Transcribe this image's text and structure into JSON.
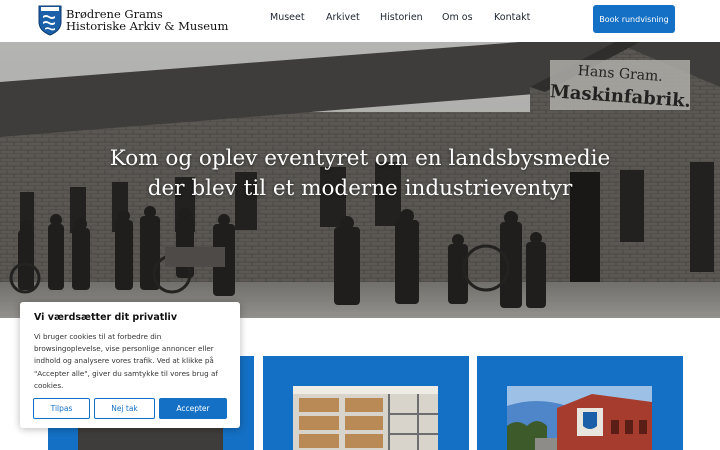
{
  "header": {
    "logo_line1": "Brødrene Grams",
    "logo_line2": "Historiske Arkiv & Museum",
    "nav": [
      {
        "label": "Museet"
      },
      {
        "label": "Arkivet"
      },
      {
        "label": "Historien"
      },
      {
        "label": "Om os"
      },
      {
        "label": "Kontakt"
      }
    ],
    "cta_label": "Book rundvisning"
  },
  "hero": {
    "title_line1": "Kom og oplev eventyret om en landsbysmedie",
    "title_line2": "der blev til et moderne industrieventyr",
    "sign_line1": "Hans Gram.",
    "sign_line2": "Maskinfabrik."
  },
  "cookie": {
    "title": "Vi værdsætter dit privatliv",
    "body": "Vi bruger cookies til at forbedre din browsingoplevelse, vise personlige annoncer eller indhold og analysere vores trafik. Ved at klikke på \"Accepter alle\", giver du samtykke til vores brug af cookies.",
    "customize_label": "Tilpas",
    "reject_label": "Nej tak",
    "accept_label": "Accepter"
  },
  "colors": {
    "accent": "#1470c4",
    "header_bg": "#ffffff",
    "text": "#1d2530"
  }
}
